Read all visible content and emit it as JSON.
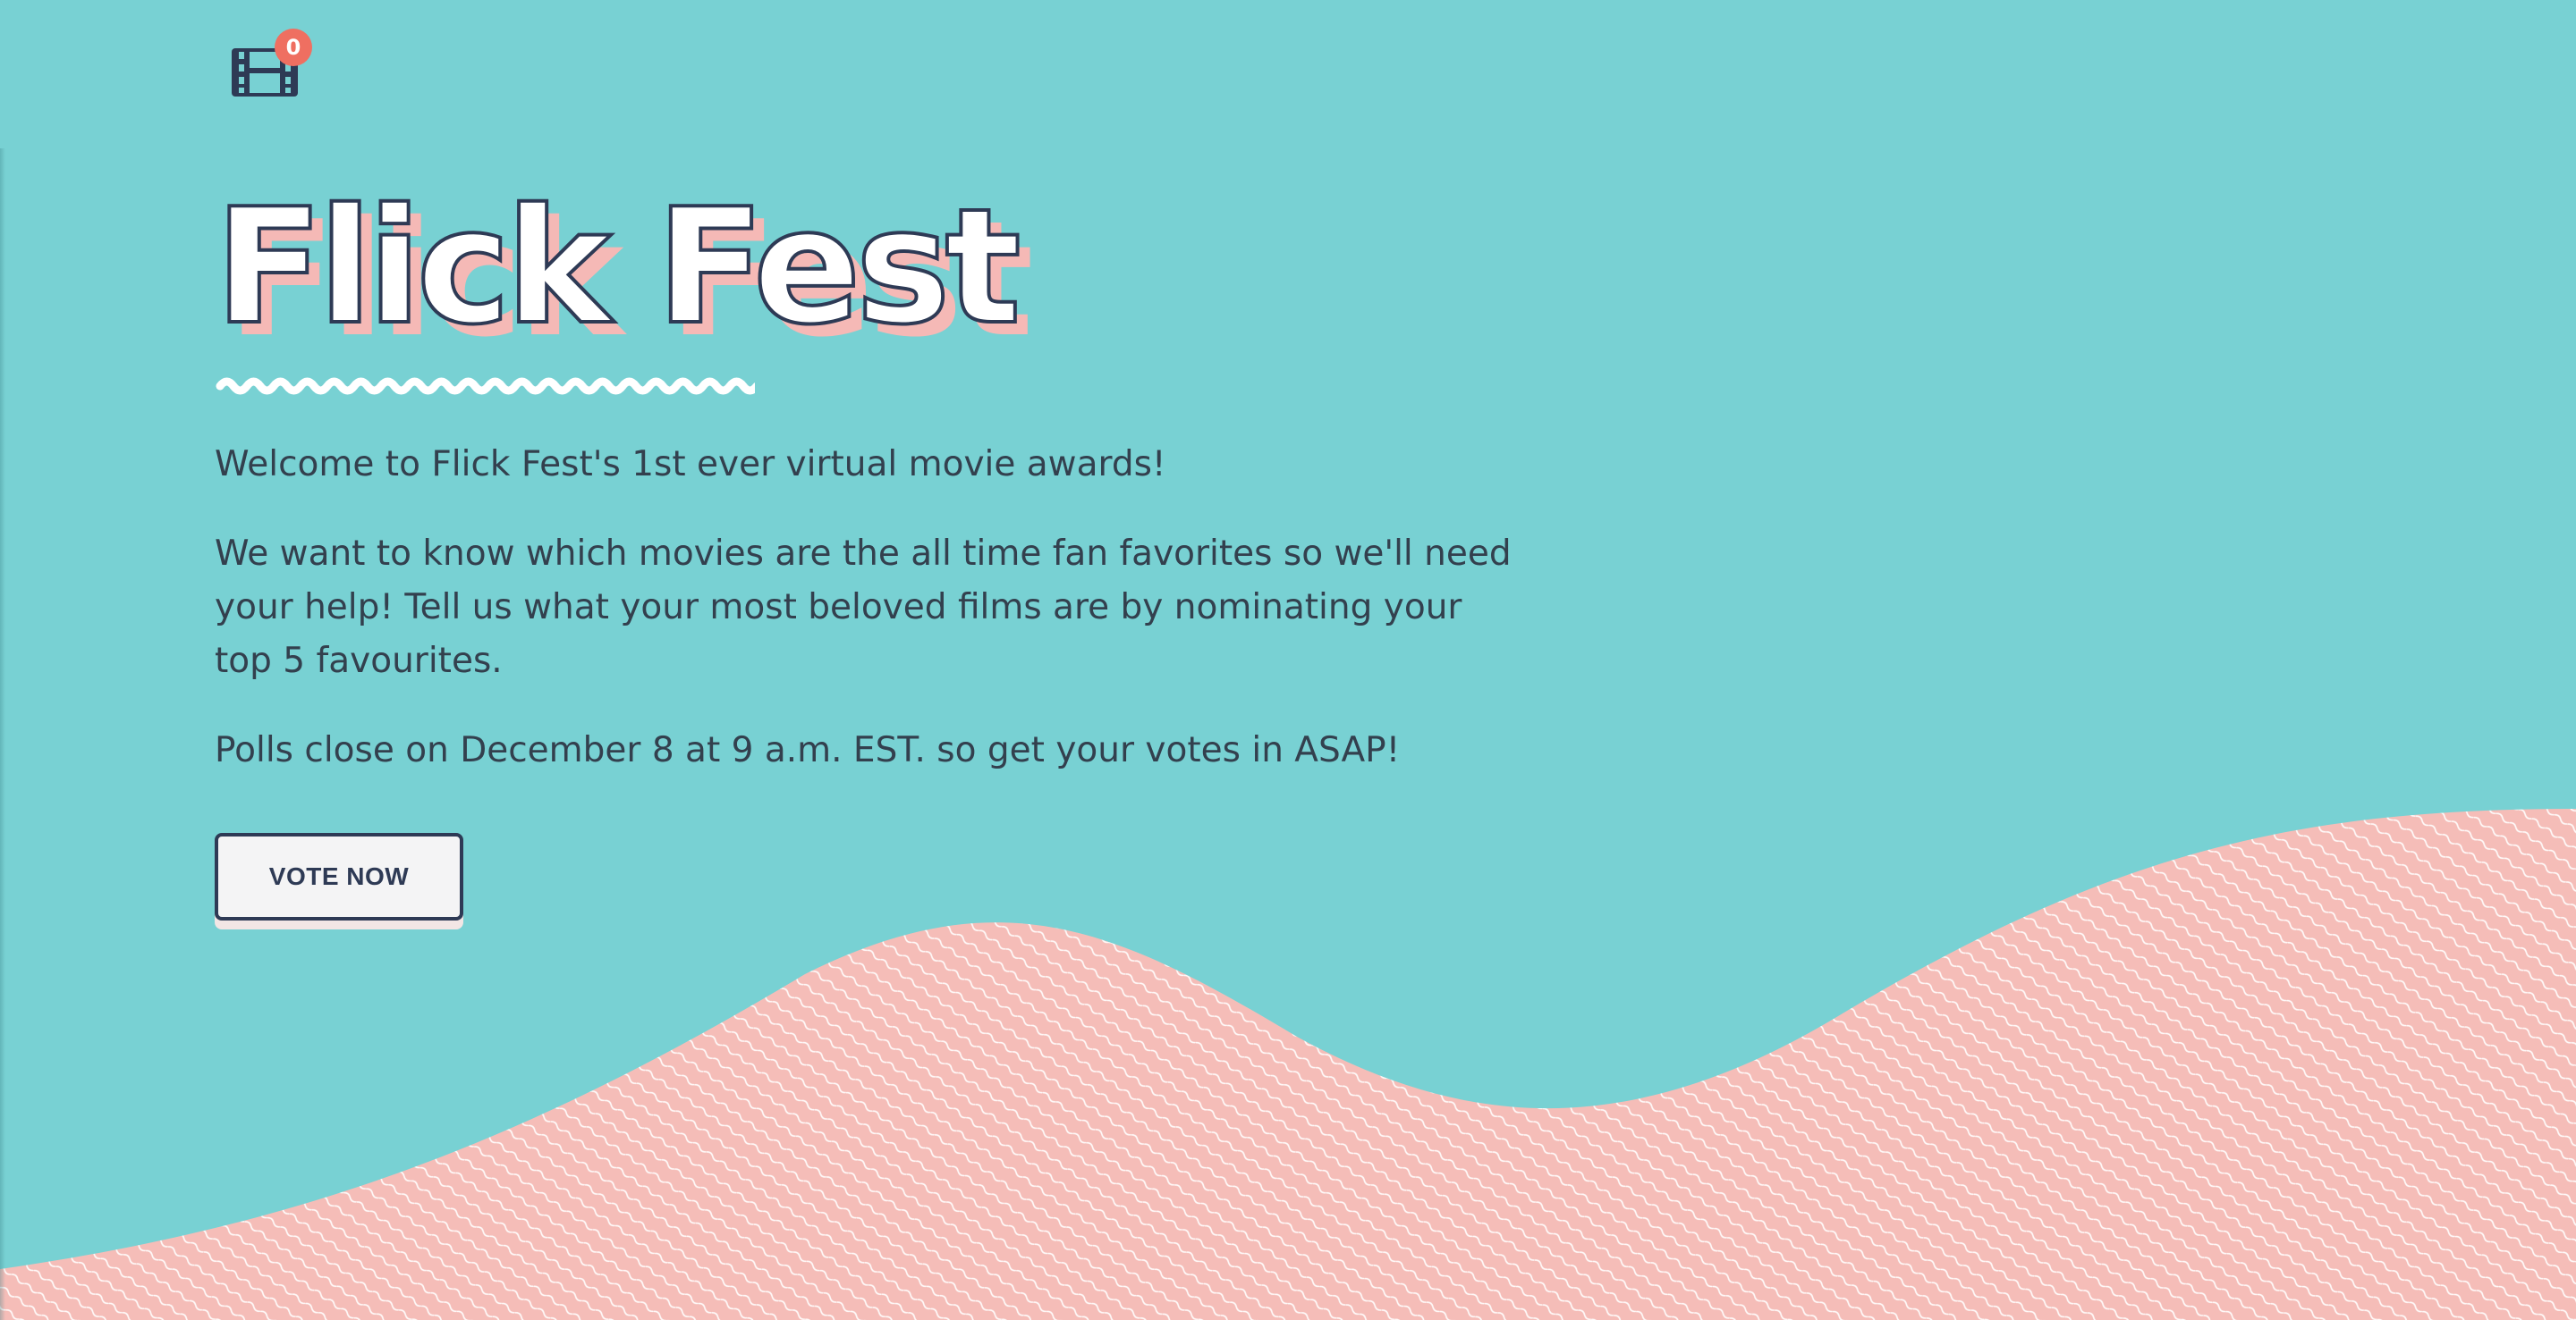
{
  "header": {
    "film_icon": "film-reel-icon",
    "badge_count": "0"
  },
  "hero": {
    "title": "Flick Fest",
    "paragraphs": [
      "Welcome to Flick Fest's 1st ever virtual movie awards!",
      "We want to know which movies are the all time fan favorites so we'll need your help! Tell us what your most beloved films are by nominating your top 5 favourites.",
      "Polls close on December 8 at 9 a.m. EST. so get your votes in ASAP!"
    ],
    "vote_button_label": "VOTE NOW"
  },
  "colors": {
    "background": "#78d1d3",
    "wave": "#f5bdb8",
    "navy": "#2e3a55",
    "badge": "#ef6f61"
  }
}
